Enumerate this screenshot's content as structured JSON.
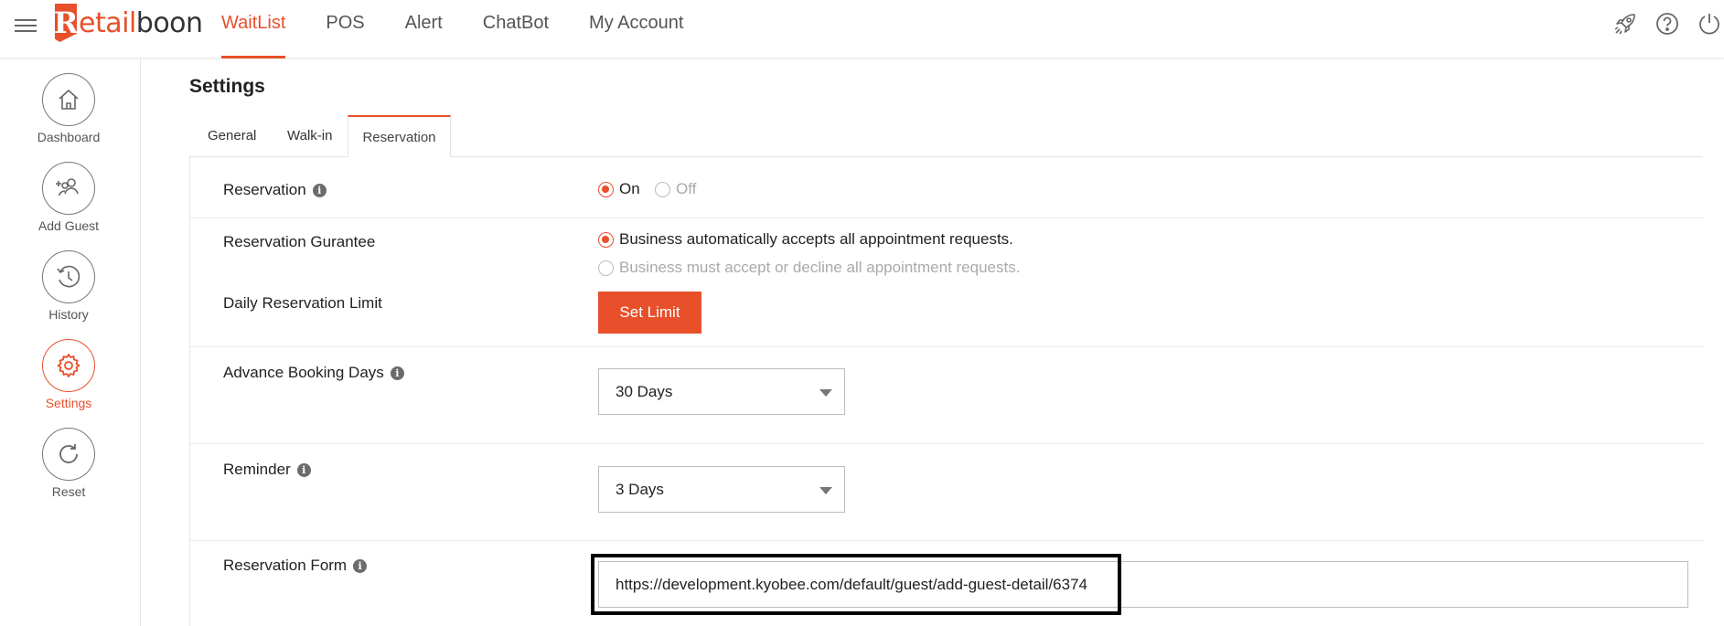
{
  "brand": {
    "logo_letter": "R",
    "logo_accent": "etail",
    "logo_rest": "boon",
    "accent_color": "#e8502b"
  },
  "topnav": [
    {
      "label": "WaitList",
      "active": true
    },
    {
      "label": "POS",
      "active": false
    },
    {
      "label": "Alert",
      "active": false
    },
    {
      "label": "ChatBot",
      "active": false
    },
    {
      "label": "My Account",
      "active": false
    }
  ],
  "top_icons": [
    "rocket-icon",
    "help-icon",
    "power-icon"
  ],
  "sidebar": {
    "items": [
      {
        "label": "Dashboard",
        "icon": "home-icon",
        "active": false
      },
      {
        "label": "Add Guest",
        "icon": "add-user-icon",
        "active": false
      },
      {
        "label": "History",
        "icon": "history-icon",
        "active": false
      },
      {
        "label": "Settings",
        "icon": "gear-icon",
        "active": true
      },
      {
        "label": "Reset",
        "icon": "refresh-icon",
        "active": false
      }
    ]
  },
  "page": {
    "title": "Settings",
    "tabs": [
      {
        "label": "General",
        "active": false
      },
      {
        "label": "Walk-in",
        "active": false
      },
      {
        "label": "Reservation",
        "active": true
      }
    ]
  },
  "settings": {
    "reservation": {
      "label": "Reservation",
      "on_label": "On",
      "off_label": "Off",
      "value": "On"
    },
    "guarantee": {
      "label": "Reservation Gurantee",
      "options": [
        {
          "label": "Business automatically accepts all appointment requests.",
          "selected": true
        },
        {
          "label": "Business must accept or decline all appointment requests.",
          "selected": false
        }
      ]
    },
    "daily_limit": {
      "label": "Daily Reservation Limit",
      "button_label": "Set Limit"
    },
    "advance_booking": {
      "label": "Advance Booking Days",
      "value": "30 Days"
    },
    "reminder": {
      "label": "Reminder",
      "value": "3 Days"
    },
    "reservation_form": {
      "label": "Reservation Form",
      "url": "https://development.kyobee.com/default/guest/add-guest-detail/6374"
    }
  }
}
